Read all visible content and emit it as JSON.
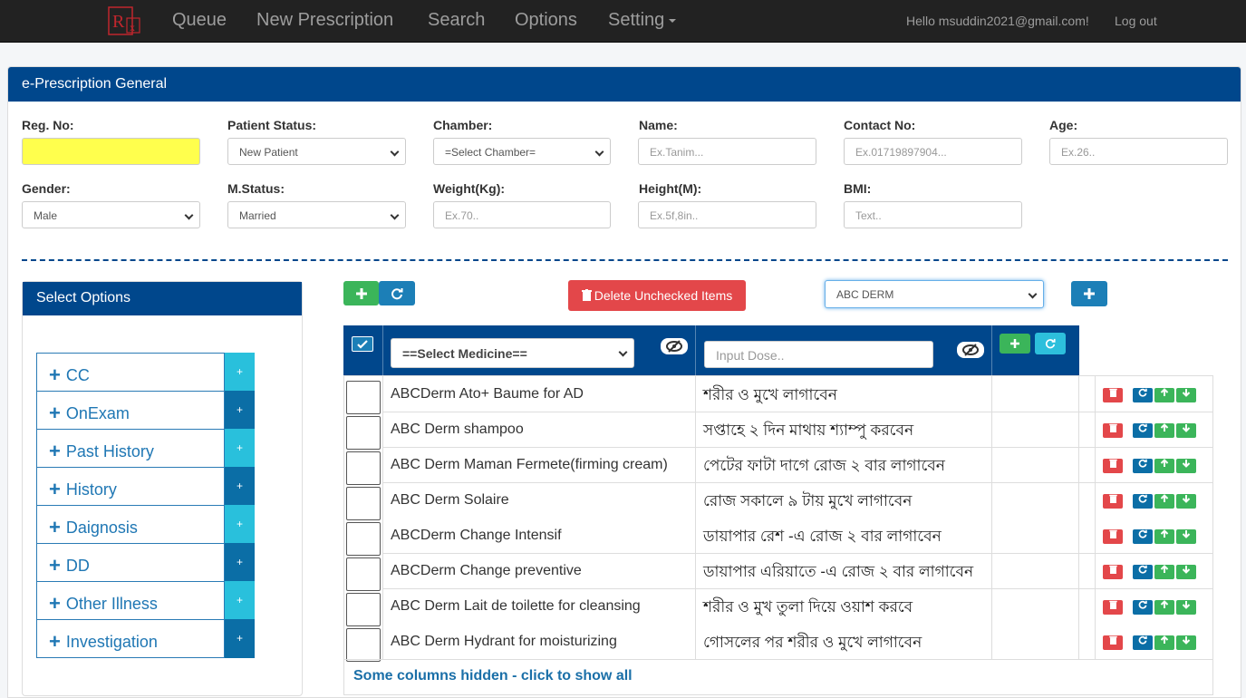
{
  "nav": {
    "items": [
      "Queue",
      "New Prescription",
      "Search",
      "Options",
      "Setting"
    ],
    "greeting": "Hello msuddin2021@gmail.com!",
    "logout": "Log out"
  },
  "panel": {
    "title": "e-Prescription General"
  },
  "form": {
    "reg_no": {
      "label": "Reg. No:",
      "value": ""
    },
    "patient_status": {
      "label": "Patient Status:",
      "value": "New Patient"
    },
    "chamber": {
      "label": "Chamber:",
      "value": "=Select Chamber="
    },
    "name": {
      "label": "Name:",
      "placeholder": "Ex.Tanim..."
    },
    "contact": {
      "label": "Contact No:",
      "placeholder": "Ex.01719897904..."
    },
    "age": {
      "label": "Age:",
      "placeholder": "Ex.26.."
    },
    "gender": {
      "label": "Gender:",
      "value": "Male"
    },
    "mstatus": {
      "label": "M.Status:",
      "value": "Married"
    },
    "weight": {
      "label": "Weight(Kg):",
      "placeholder": "Ex.70.."
    },
    "height": {
      "label": "Height(M):",
      "placeholder": "Ex.5f,8in.."
    },
    "bmi": {
      "label": "BMI:",
      "placeholder": "Text.."
    }
  },
  "options": {
    "title": "Select Options",
    "items": [
      "CC",
      "OnExam",
      "Past History",
      "History",
      "Daignosis",
      "DD",
      "Other Illness",
      "Investigation"
    ],
    "plus": "+"
  },
  "toolbar": {
    "delete_label": "Delete Unchecked Items",
    "template_value": "ABC DERM"
  },
  "table": {
    "select_medicine": "==Select Medicine==",
    "dose_placeholder": "Input Dose..",
    "rows": [
      {
        "name": "ABCDerm Ato+ Baume for AD",
        "dose": "শরীর ও মুখে লাগাবেন"
      },
      {
        "name": "ABC Derm shampoo",
        "dose": "সপ্তাহে ২ দিন মাথায় শ্যাম্পু করবেন"
      },
      {
        "name": "ABC Derm Maman Fermete(firming cream)",
        "dose": "পেটের ফাটা দাগে রোজ ২ বার লাগাবেন"
      },
      {
        "name": "ABC Derm Solaire",
        "dose": "রোজ সকালে ৯ টায় মুখে লাগাবেন"
      },
      {
        "name": "ABCDerm Change Intensif",
        "dose": "ডায়াপার রেশ -এ রোজ ২ বার লাগাবেন"
      },
      {
        "name": "ABCDerm Change preventive",
        "dose": "ডায়াপার এরিয়াতে -এ রোজ ২ বার লাগাবেন"
      },
      {
        "name": "ABC Derm Lait de toilette for cleansing",
        "dose": "শরীর ও মুখ তুলা দিয়ে ওয়াশ করবে"
      },
      {
        "name": "ABC Derm Hydrant for moisturizing",
        "dose": "গোসলের পর শরীর ও মুখে লাগাবেন"
      }
    ],
    "footer": "Some columns hidden - click to show all"
  },
  "colors": {
    "primary": "#00478c",
    "green": "#3bb55a",
    "red": "#e3474a",
    "cyan": "#2dbfdc",
    "reg_bg": "#ffff4d"
  }
}
